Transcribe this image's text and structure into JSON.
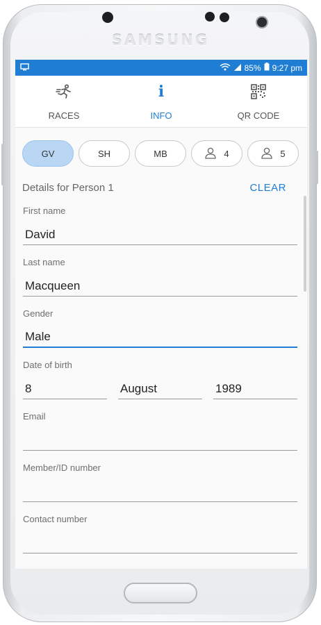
{
  "device": {
    "brand": "SAMSUNG"
  },
  "status_bar": {
    "battery": "85%",
    "time": "9:27 pm",
    "left_icon": "screen-cast-icon",
    "icons": [
      "wifi-icon",
      "signal-icon",
      "battery-icon"
    ]
  },
  "tabs": [
    {
      "label": "RACES",
      "icon": "runner-icon",
      "active": false
    },
    {
      "label": "INFO",
      "icon": "info-icon",
      "active": true
    },
    {
      "label": "QR CODE",
      "icon": "qr-code-icon",
      "active": false
    }
  ],
  "person_chips": [
    {
      "label": "GV",
      "active": true
    },
    {
      "label": "SH",
      "active": false
    },
    {
      "label": "MB",
      "active": false
    },
    {
      "label": "4",
      "icon": "person-icon",
      "active": false
    },
    {
      "label": "5",
      "icon": "person-icon",
      "active": false
    }
  ],
  "details_title": "Details for Person 1",
  "clear_label": "CLEAR",
  "form": {
    "first_name": {
      "label": "First name",
      "value": "David"
    },
    "last_name": {
      "label": "Last name",
      "value": "Macqueen"
    },
    "gender": {
      "label": "Gender",
      "value": "Male"
    },
    "dob": {
      "label": "Date of birth",
      "day": "8",
      "month": "August",
      "year": "1989"
    },
    "email": {
      "label": "Email",
      "value": ""
    },
    "member_id": {
      "label": "Member/ID number",
      "value": ""
    },
    "contact": {
      "label": "Contact number",
      "value": ""
    }
  },
  "colors": {
    "accent": "#1f7ed3",
    "chip_active": "#b9d7f5",
    "status_bar": "#1f7ed3"
  }
}
